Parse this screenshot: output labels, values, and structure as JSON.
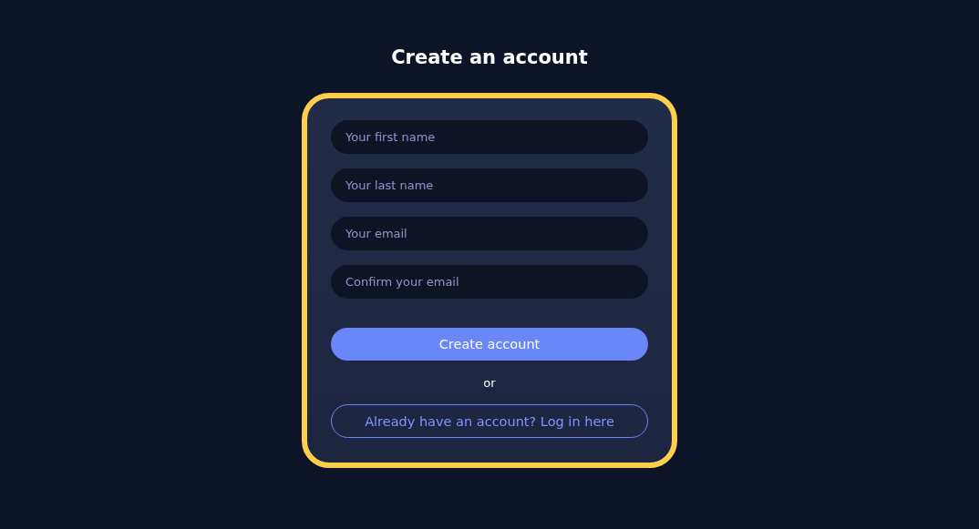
{
  "title": "Create an account",
  "form": {
    "fields": [
      {
        "placeholder": "Your first name"
      },
      {
        "placeholder": "Your last name"
      },
      {
        "placeholder": "Your email"
      },
      {
        "placeholder": "Confirm your email"
      }
    ],
    "submit": "Create account",
    "separator": "or",
    "login_link": "Already have an account? Log in here"
  }
}
